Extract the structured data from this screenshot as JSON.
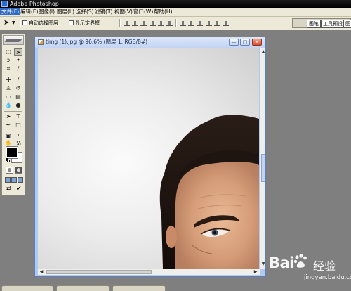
{
  "app": {
    "title": "Adobe Photoshop"
  },
  "menu": [
    {
      "label": "文件(F)",
      "active": true
    },
    {
      "label": "编辑(E)"
    },
    {
      "label": "图像(I)"
    },
    {
      "label": "图层(L)"
    },
    {
      "label": "选择(S)"
    },
    {
      "label": "滤镜(T)"
    },
    {
      "label": "视图(V)"
    },
    {
      "label": "窗口(W)"
    },
    {
      "label": "帮助(H)"
    }
  ],
  "options": {
    "auto_select_layer": {
      "label": "自动选择图层",
      "checked": false
    },
    "show_bounding_box": {
      "label": "显示定界框",
      "checked": false
    }
  },
  "palette_well": {
    "tabs": [
      "画笔",
      "工具预设",
      "图"
    ]
  },
  "document": {
    "title": "timg (1).jpg @ 96.6% (图层 1, RGB/8#)",
    "min_symbol": "—",
    "max_symbol": "□",
    "close_symbol": "✕"
  },
  "watermark": {
    "brand": "Bai",
    "brand_suffix": "经验",
    "url": "jingyan.baidu.com"
  },
  "colors": {
    "accent": "#316ac5",
    "foreground": "#000000",
    "background": "#ffffff"
  }
}
